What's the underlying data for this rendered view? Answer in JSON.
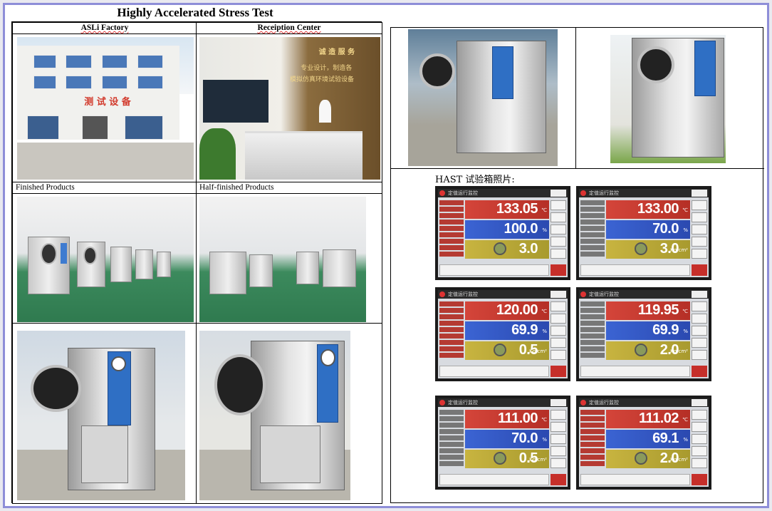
{
  "title": "Highly Accelerated Stress Test",
  "left_grid": {
    "captions": {
      "factory": "ASLi Factory",
      "reception": "Receiption Center",
      "finished": "Finished Products",
      "half_finished": "Half-finished Products"
    },
    "factory_sign": "测 试 设 备",
    "reception_sign_1": "诚 造 服 务",
    "reception_sign_2": "专业设计，制造各",
    "reception_sign_3": "模拟仿真环境试验设备"
  },
  "right_grid": {
    "hast_label": "HAST 试验箱照片:",
    "screens": [
      {
        "title": "定值运行监控",
        "values": [
          "133.05",
          "100.0",
          "3.0"
        ],
        "units": [
          "℃",
          "%",
          ""
        ]
      },
      {
        "title": "定值运行监控",
        "values": [
          "133.00",
          "70.0",
          "3.0"
        ],
        "units": [
          "℃",
          "%",
          "Kg/cm²"
        ]
      },
      {
        "title": "定值运行监控",
        "values": [
          "120.00",
          "69.9",
          "0.5"
        ],
        "units": [
          "℃",
          "%",
          "Kg/cm²"
        ]
      },
      {
        "title": "定值运行监控",
        "values": [
          "119.95",
          "69.9",
          "2.0"
        ],
        "units": [
          "℃",
          "%",
          "Kg/cm²"
        ]
      },
      {
        "title": "定值运行监控",
        "values": [
          "111.00",
          "70.0",
          "0.5"
        ],
        "units": [
          "℃",
          "%",
          "Kg/cm²"
        ]
      },
      {
        "title": "定值运行监控",
        "values": [
          "111.02",
          "69.1",
          "2.0"
        ],
        "units": [
          "℃",
          "%",
          "Kg/cm²"
        ]
      }
    ]
  },
  "colors": {
    "frame_border": "#8e8ed8",
    "temp_row": "#d4453a",
    "humidity_row": "#3b64d3",
    "pressure_row": "#c8b440"
  }
}
